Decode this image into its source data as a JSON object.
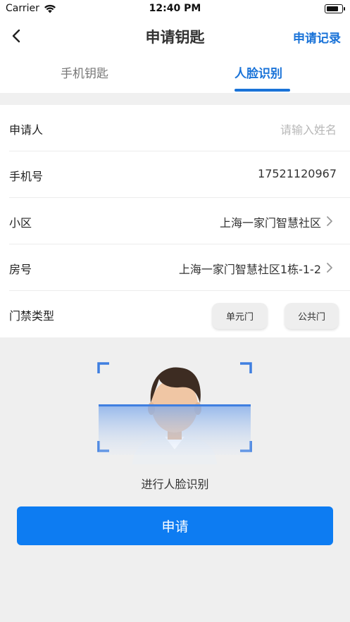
{
  "status_bar": {
    "carrier": "Carrier",
    "time": "12:40 PM",
    "battery_level": 0.85,
    "icons": [
      "wifi-icon",
      "battery-icon"
    ]
  },
  "nav": {
    "back_icon": "chevron-left-icon",
    "title": "申请钥匙",
    "right_action": "申请记录"
  },
  "tabs": [
    {
      "label": "手机钥匙",
      "active": false
    },
    {
      "label": "人脸识别",
      "active": true
    }
  ],
  "form": {
    "applicant": {
      "label": "申请人",
      "placeholder": "请输入姓名",
      "value": ""
    },
    "phone": {
      "label": "手机号",
      "value": "17521120967"
    },
    "community": {
      "label": "小区",
      "value": "上海一家门智慧社区"
    },
    "room": {
      "label": "房号",
      "value": "上海一家门智慧社区1栋-1-2"
    },
    "access_type": {
      "label": "门禁类型",
      "options": [
        "单元门",
        "公共门"
      ]
    }
  },
  "face": {
    "caption": "进行人脸识别",
    "icon": "face-scan-illustration"
  },
  "submit_label": "申请",
  "colors": {
    "accent": "#1a73d8",
    "button": "#0d7cf2",
    "background": "#efefef"
  }
}
